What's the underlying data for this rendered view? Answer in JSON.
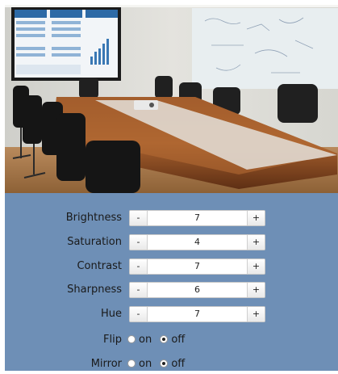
{
  "image_controls": [
    {
      "label": "Brightness",
      "value": "7",
      "minus": "-",
      "plus": "+"
    },
    {
      "label": "Saturation",
      "value": "4",
      "minus": "-",
      "plus": "+"
    },
    {
      "label": "Contrast",
      "value": "7",
      "minus": "-",
      "plus": "+"
    },
    {
      "label": "Sharpness",
      "value": "6",
      "minus": "-",
      "plus": "+"
    },
    {
      "label": "Hue",
      "value": "7",
      "minus": "-",
      "plus": "+"
    }
  ],
  "flip": {
    "label": "Flip",
    "on_label": "on",
    "off_label": "off",
    "selected": "off"
  },
  "mirror": {
    "label": "Mirror",
    "on_label": "on",
    "off_label": "off",
    "selected": "off"
  },
  "colors": {
    "panel_background": "#6e8fb6",
    "button_background": "#ffffff"
  },
  "preview": {
    "subject": "conference room camera view"
  }
}
